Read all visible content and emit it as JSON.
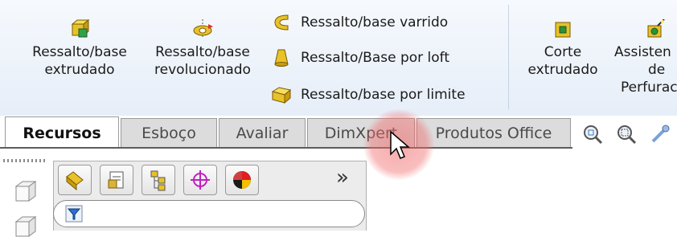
{
  "ribbon": {
    "extruded_boss": {
      "line1": "Ressalto/base",
      "line2": "extrudado"
    },
    "revolved_boss": {
      "line1": "Ressalto/base",
      "line2": "revolucionado"
    },
    "swept_boss": "Ressalto/base varrido",
    "lofted_boss": "Ressalto/Base por loft",
    "boundary_boss": "Ressalto/base por limite",
    "extruded_cut": {
      "line1": "Corte",
      "line2": "extrudado"
    },
    "hole_wizard": {
      "line1": "Assisten",
      "line2": "de",
      "line3": "Perfurac"
    }
  },
  "tabs": [
    {
      "label": "Recursos",
      "active": true
    },
    {
      "label": "Esboço",
      "active": false
    },
    {
      "label": "Avaliar",
      "active": false
    },
    {
      "label": "DimXpert",
      "active": false
    },
    {
      "label": "Produtos Office",
      "active": false
    }
  ],
  "view_icons": [
    "zoom-to-fit-icon",
    "zoom-to-area-icon",
    "previous-view-icon"
  ],
  "feature_manager": {
    "tabs": [
      "featuremanager-tree-icon",
      "propertymanager-icon",
      "configurationmanager-icon",
      "dimxpertmanager-icon",
      "displaymanager-icon"
    ],
    "more": "»",
    "filter_icon": "filter-icon"
  },
  "colors": {
    "accent": "#d4a000",
    "cursor_highlight": "#f06464",
    "tab_active": "#ffffff",
    "tab_inactive": "#dcdcdc"
  }
}
